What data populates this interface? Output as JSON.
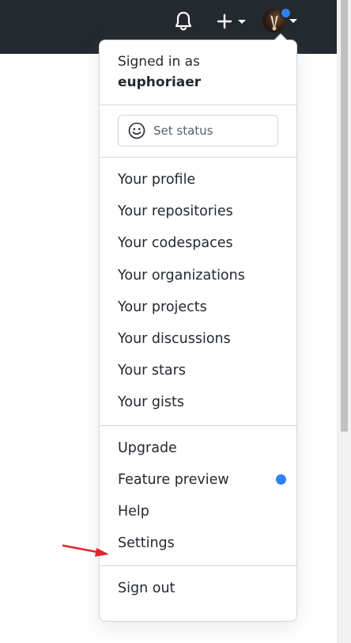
{
  "header": {
    "bell_icon": "bell-icon",
    "create_icon": "plus-icon",
    "avatar_badge_color": "#2f81f7"
  },
  "dropdown": {
    "signed_in_label": "Signed in as",
    "username": "euphoriaer",
    "set_status_label": "Set status",
    "profile_items": [
      "Your profile",
      "Your repositories",
      "Your codespaces",
      "Your organizations",
      "Your projects",
      "Your discussions",
      "Your stars",
      "Your gists"
    ],
    "settings_items": {
      "upgrade": "Upgrade",
      "feature_preview": "Feature preview",
      "help": "Help",
      "settings": "Settings"
    },
    "sign_out": "Sign out"
  },
  "annotation": {
    "arrow_color": "#e5232b",
    "points_to": "Settings"
  }
}
